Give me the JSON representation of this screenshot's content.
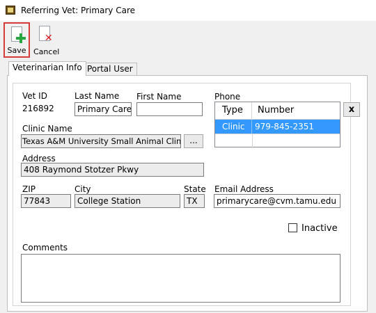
{
  "window": {
    "title": "Referring Vet: Primary Care"
  },
  "toolbar": {
    "save_label": "Save",
    "cancel_label": "Cancel"
  },
  "tabs": [
    {
      "label": "Veterinarian Info"
    },
    {
      "label": "Portal User"
    }
  ],
  "form": {
    "vet_id": {
      "label": "Vet ID",
      "value": "216892"
    },
    "last_name": {
      "label": "Last Name",
      "value": "Primary Care"
    },
    "first_name": {
      "label": "First Name",
      "value": ""
    },
    "phone": {
      "label": "Phone",
      "columns": [
        "Type",
        "Number"
      ],
      "rows": [
        {
          "type": "Clinic",
          "number": "979-845-2351"
        }
      ],
      "remove_label": "x"
    },
    "clinic_name": {
      "label": "Clinic Name",
      "value": "Texas A&M University Small Animal Clinic",
      "browse_label": "..."
    },
    "address": {
      "label": "Address",
      "value": "408 Raymond Stotzer Pkwy"
    },
    "zip": {
      "label": "ZIP",
      "value": "77843"
    },
    "city": {
      "label": "City",
      "value": "College Station"
    },
    "state": {
      "label": "State",
      "value": "TX"
    },
    "email": {
      "label": "Email Address",
      "value": "primarycare@cvm.tamu.edu"
    },
    "inactive": {
      "label": "Inactive",
      "checked": false
    },
    "comments": {
      "label": "Comments",
      "value": ""
    }
  }
}
